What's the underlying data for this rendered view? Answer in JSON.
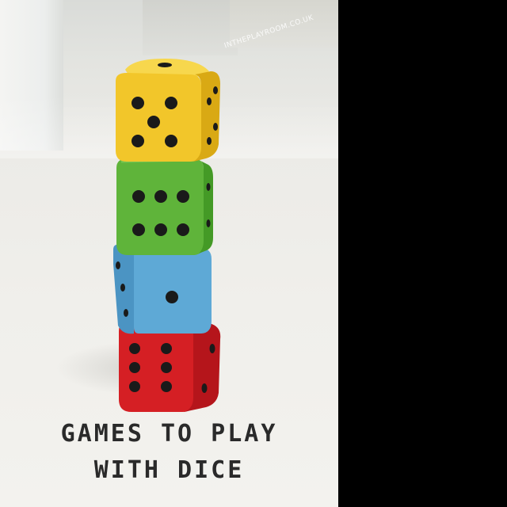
{
  "image": {
    "watermark": "INTHEPLAYROOM.CO.UK",
    "title_line1": "GAMES TO PLAY",
    "title_line2": "WITH DICE",
    "dice": [
      {
        "color": "#f2c62a",
        "face": 5
      },
      {
        "color": "#5fb43a",
        "face": 6
      },
      {
        "color": "#5ea9d6",
        "face": 1
      },
      {
        "color": "#d51f24",
        "face": 6
      }
    ],
    "colors": {
      "background_right": "#000000",
      "text": "#2a2a2a"
    }
  }
}
